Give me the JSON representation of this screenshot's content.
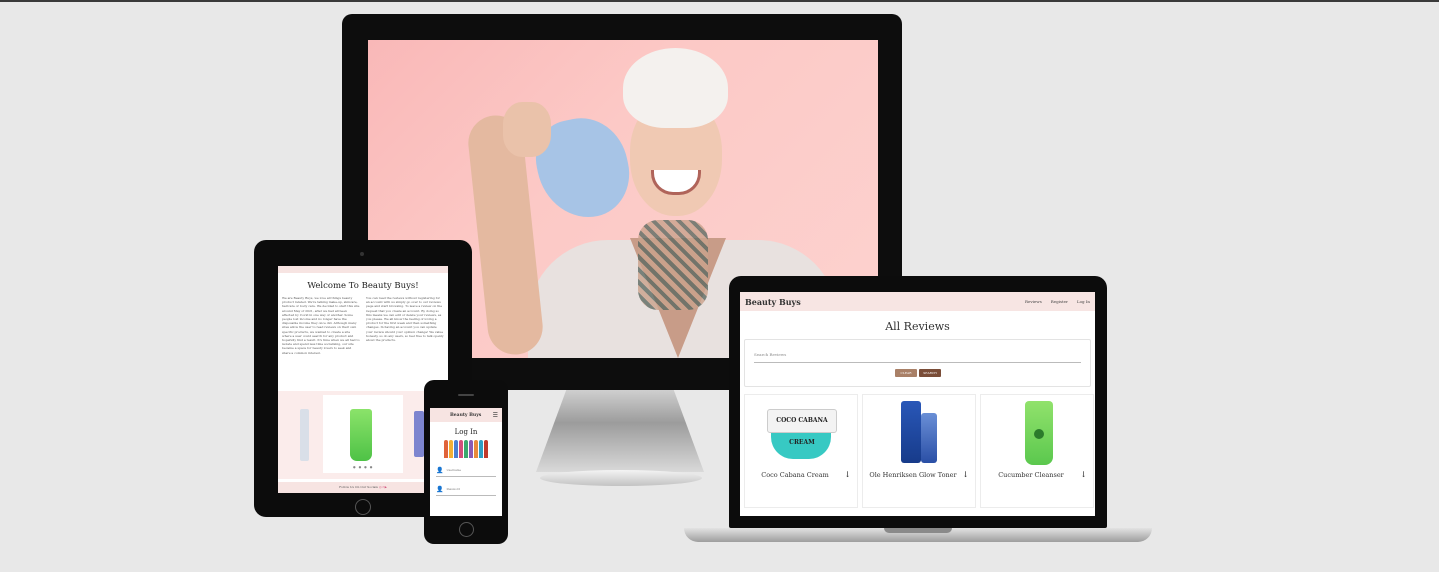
{
  "laptop": {
    "brand": "Beauty Buys",
    "nav_links": [
      "Reviews",
      "Register",
      "Log In"
    ],
    "page_title": "All Reviews",
    "search_placeholder": "Search Reviews",
    "clear_label": "CLEAR",
    "search_label": "SEARCH",
    "products": [
      {
        "name": "Coco Cabana Cream",
        "label": "COCO CABANA CREAM"
      },
      {
        "name": "Ole Henriksen Glow Toner"
      },
      {
        "name": "Cucumber Cleanser"
      }
    ]
  },
  "tablet": {
    "title": "Welcome To Beauty Buys!",
    "col1": "We are Beauty Buys, we love all things beauty product related. We're talking make-up, skincare, haircare or body care. We decided to start this site around May of 2021, after we had all been affected by Covid in one way or another. Some people lost income and no longer have the disposable income they once did. Although many sites allow the user to read reviews on their own specific products, we wanted to create a site where a user could search for any product and hopefully find a result. It's time when we all had to isolate and spend less time socialising, our site became a space for beauty lovers to seek and share a common interest.",
    "col2": "You can read the reviews without registering for an account with us simply go over to our reviews page and start browsing. To leave a review on the request that you create an account. By doing so this means we can edit or delete your reviews, as you please. We all know the feeling of loving a product for the first week and then something changes. In having an account you can update your review should your opinion change! We value honesty, so do any users, so feel free to talk openly about the products.",
    "footer": "Follow Us On Our Socials"
  },
  "phone": {
    "brand": "Beauty Buys",
    "title": "Log In",
    "username_label": "Username",
    "password_label": "Password"
  }
}
